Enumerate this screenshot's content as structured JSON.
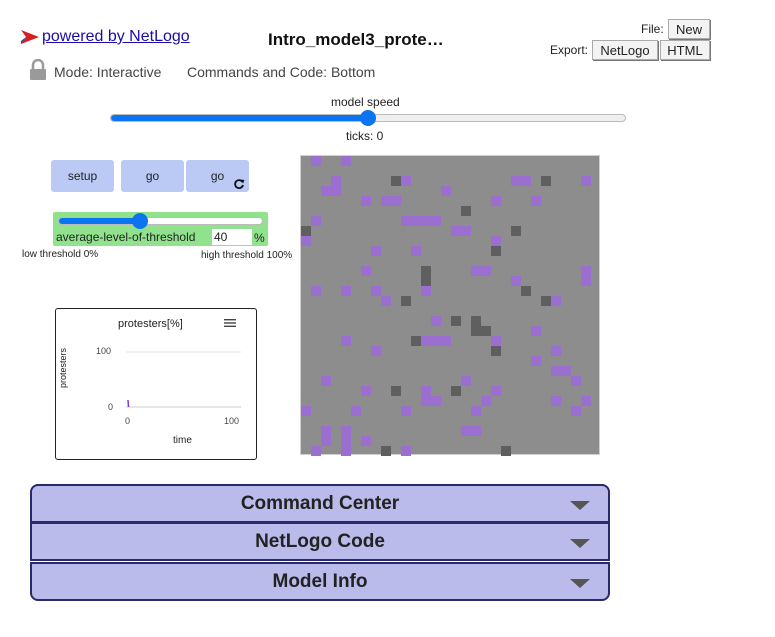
{
  "header": {
    "powered_by": "powered by NetLogo",
    "title": "Intro_model3_prote…",
    "file_label": "File:",
    "new_button": "New",
    "export_label": "Export:",
    "export_netlogo": "NetLogo",
    "export_html": "HTML",
    "mode_label": "Mode: Interactive",
    "commands_label": "Commands and Code: Bottom"
  },
  "speed": {
    "label": "model speed",
    "value_fraction": 0.5,
    "ticks_label": "ticks: 0"
  },
  "buttons": {
    "setup": "setup",
    "go": "go",
    "go_forever": "go"
  },
  "threshold_slider": {
    "name": "average-level-of-threshold",
    "value": "40",
    "units": "%",
    "min": 0,
    "max": 100,
    "low_note": "low threshold 0%",
    "high_note": "high threshold 100%"
  },
  "plot": {
    "title": "protesters[%]",
    "ylabel": "protesters",
    "xlabel": "time",
    "y_ticks": [
      "100",
      "0"
    ],
    "x_ticks": [
      "0",
      "100"
    ]
  },
  "world": {
    "colors": {
      "background": "#8d8d8d",
      "purple": "#9b6fcf",
      "dark": "#5f5f5f"
    },
    "purple_patches": [
      [
        1,
        0
      ],
      [
        4,
        0
      ],
      [
        3,
        2
      ],
      [
        10,
        2
      ],
      [
        21,
        2
      ],
      [
        22,
        2
      ],
      [
        28,
        2
      ],
      [
        2,
        3
      ],
      [
        3,
        3
      ],
      [
        14,
        3
      ],
      [
        6,
        4
      ],
      [
        8,
        4
      ],
      [
        9,
        4
      ],
      [
        19,
        4
      ],
      [
        23,
        4
      ],
      [
        1,
        6
      ],
      [
        10,
        6
      ],
      [
        11,
        6
      ],
      [
        12,
        6
      ],
      [
        13,
        6
      ],
      [
        15,
        7
      ],
      [
        16,
        7
      ],
      [
        21,
        7
      ],
      [
        0,
        8
      ],
      [
        19,
        8
      ],
      [
        7,
        9
      ],
      [
        11,
        9
      ],
      [
        18,
        11
      ],
      [
        6,
        11
      ],
      [
        17,
        11
      ],
      [
        28,
        11
      ],
      [
        12,
        12
      ],
      [
        21,
        12
      ],
      [
        28,
        12
      ],
      [
        1,
        13
      ],
      [
        4,
        13
      ],
      [
        7,
        13
      ],
      [
        12,
        13
      ],
      [
        8,
        14
      ],
      [
        25,
        14
      ],
      [
        13,
        16
      ],
      [
        23,
        17
      ],
      [
        4,
        18
      ],
      [
        12,
        18
      ],
      [
        13,
        18
      ],
      [
        14,
        18
      ],
      [
        19,
        18
      ],
      [
        7,
        19
      ],
      [
        25,
        19
      ],
      [
        23,
        20
      ],
      [
        25,
        21
      ],
      [
        26,
        21
      ],
      [
        2,
        22
      ],
      [
        16,
        22
      ],
      [
        27,
        22
      ],
      [
        6,
        23
      ],
      [
        12,
        23
      ],
      [
        19,
        23
      ],
      [
        12,
        24
      ],
      [
        13,
        24
      ],
      [
        18,
        24
      ],
      [
        25,
        24
      ],
      [
        28,
        24
      ],
      [
        0,
        25
      ],
      [
        5,
        25
      ],
      [
        10,
        25
      ],
      [
        17,
        25
      ],
      [
        27,
        25
      ],
      [
        2,
        27
      ],
      [
        4,
        27
      ],
      [
        16,
        27
      ],
      [
        17,
        27
      ],
      [
        2,
        28
      ],
      [
        4,
        28
      ],
      [
        6,
        28
      ],
      [
        1,
        29
      ],
      [
        4,
        29
      ],
      [
        10,
        29
      ]
    ],
    "dark_patches": [
      [
        9,
        2
      ],
      [
        24,
        2
      ],
      [
        16,
        5
      ],
      [
        21,
        7
      ],
      [
        0,
        7
      ],
      [
        19,
        9
      ],
      [
        12,
        11
      ],
      [
        12,
        12
      ],
      [
        22,
        13
      ],
      [
        10,
        14
      ],
      [
        24,
        14
      ],
      [
        15,
        16
      ],
      [
        17,
        16
      ],
      [
        11,
        18
      ],
      [
        19,
        19
      ],
      [
        17,
        17
      ],
      [
        18,
        17
      ],
      [
        9,
        23
      ],
      [
        15,
        23
      ],
      [
        8,
        29
      ],
      [
        20,
        29
      ]
    ]
  },
  "accordion": {
    "command_center": "Command Center",
    "code": "NetLogo Code",
    "info": "Model Info"
  }
}
